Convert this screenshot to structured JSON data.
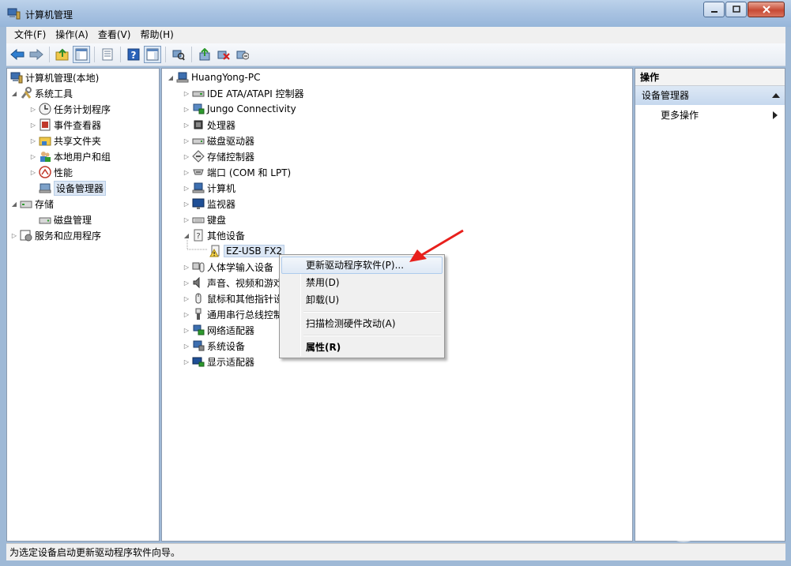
{
  "window": {
    "title": "计算机管理"
  },
  "menubar": {
    "items": [
      "文件(F)",
      "操作(A)",
      "查看(V)",
      "帮助(H)"
    ]
  },
  "left_tree": {
    "root": "计算机管理(本地)",
    "system_tools": "系统工具",
    "task_scheduler": "任务计划程序",
    "event_viewer": "事件查看器",
    "shared_folders": "共享文件夹",
    "local_users": "本地用户和组",
    "performance": "性能",
    "device_manager": "设备管理器",
    "storage": "存储",
    "disk_management": "磁盘管理",
    "services_apps": "服务和应用程序"
  },
  "devices": {
    "computer_name": "HuangYong-PC",
    "ide": "IDE ATA/ATAPI 控制器",
    "jungo": "Jungo Connectivity",
    "processor": "处理器",
    "disk_drives": "磁盘驱动器",
    "storage_ctrl": "存储控制器",
    "ports": "端口 (COM 和 LPT)",
    "computer": "计算机",
    "monitors": "监视器",
    "keyboard": "键盘",
    "other_devices": "其他设备",
    "ezusb": "EZ-USB FX2",
    "hid": "人体学输入设备",
    "sound": "声音、视频和游戏控制器",
    "mice": "鼠标和其他指针设备",
    "usb": "通用串行总线控制器",
    "network": "网络适配器",
    "system": "系统设备",
    "display": "显示适配器"
  },
  "context_menu": {
    "update_driver": "更新驱动程序软件(P)...",
    "disable": "禁用(D)",
    "uninstall": "卸载(U)",
    "scan": "扫描检测硬件改动(A)",
    "properties": "属性(R)"
  },
  "actions": {
    "header": "操作",
    "section": "设备管理器",
    "more": "更多操作"
  },
  "statusbar": {
    "text": "为选定设备启动更新驱动程序软件向导。"
  },
  "colors": {
    "accent": "#3a6ea5",
    "arrow": "#e8201c",
    "selection": "#dbe6f4"
  }
}
